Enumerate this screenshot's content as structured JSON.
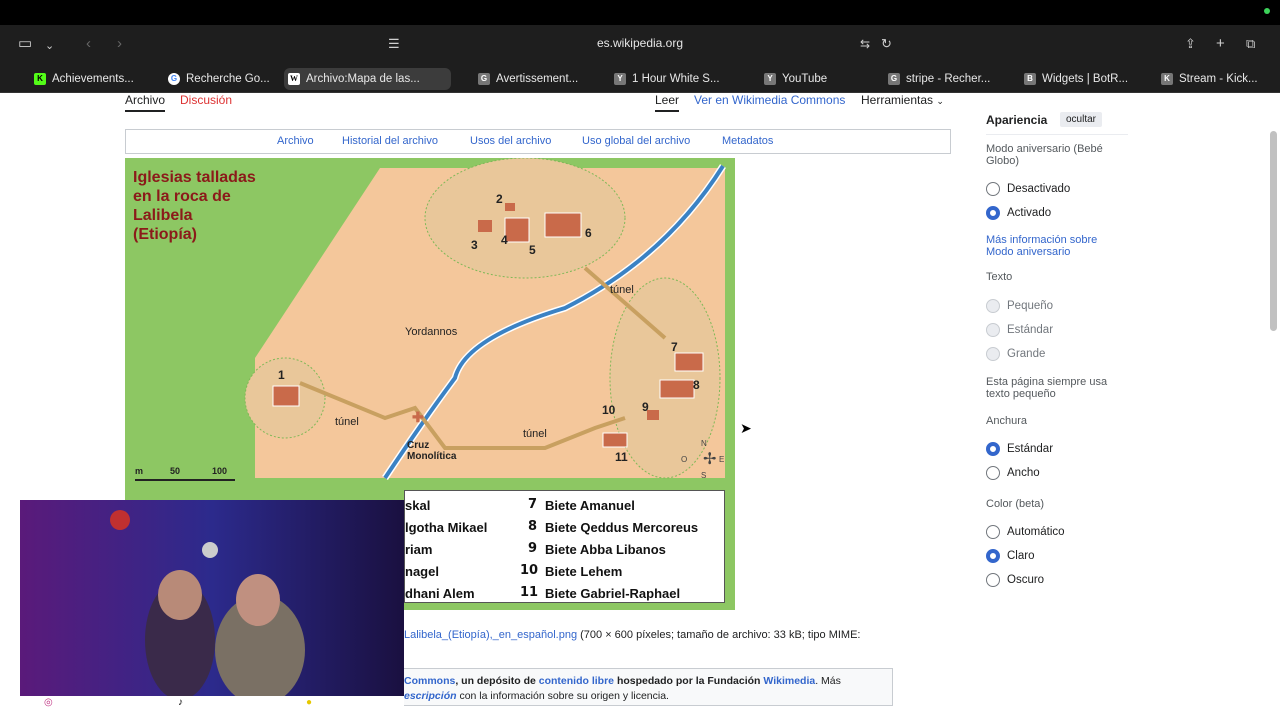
{
  "browser": {
    "url": "es.wikipedia.org",
    "tabs": [
      {
        "label": "Achievements...",
        "favicon": "K",
        "favicon_color": "#53fc18"
      },
      {
        "label": "Recherche Go...",
        "favicon": "G",
        "favicon_color": "#ffffff"
      },
      {
        "label": "Archivo:Mapa de las...",
        "favicon": "W",
        "favicon_color": "#ffffff",
        "active": true
      },
      {
        "label": "Avertissement...",
        "favicon": "G",
        "favicon_color": "#888888"
      },
      {
        "label": "1 Hour White S...",
        "favicon": "Y",
        "favicon_color": "#888888"
      },
      {
        "label": "YouTube",
        "favicon": "Y",
        "favicon_color": "#888888"
      },
      {
        "label": "stripe - Recher...",
        "favicon": "G",
        "favicon_color": "#888888"
      },
      {
        "label": "Widgets | BotR...",
        "favicon": "B",
        "favicon_color": "#888888"
      },
      {
        "label": "Stream - Kick...",
        "favicon": "K",
        "favicon_color": "#888888"
      }
    ]
  },
  "wiki": {
    "ns_tabs": {
      "archivo": "Archivo",
      "discusion": "Discusión"
    },
    "view_tabs": {
      "leer": "Leer",
      "commons": "Ver en Wikimedia Commons",
      "herramientas": "Herramientas"
    },
    "file_tabs": [
      "Archivo",
      "Historial del archivo",
      "Usos del archivo",
      "Uso global del archivo",
      "Metadatos"
    ],
    "map": {
      "title_lines": [
        "Iglesias talladas",
        "en la roca de",
        "Lalibela",
        "(Etiopía)"
      ],
      "river_label": "Yordannos",
      "tunnel_label": "túnel",
      "cross_label_lines": [
        "Cruz",
        "Monolítica"
      ],
      "numbers": [
        "1",
        "2",
        "3",
        "4",
        "5",
        "6",
        "7",
        "8",
        "9",
        "10",
        "11"
      ],
      "scale": {
        "unit": "m",
        "mid": "50",
        "end": "100"
      },
      "compass": {
        "n": "N",
        "s": "S",
        "e": "E",
        "o": "O"
      },
      "legend_left": [
        "skal",
        "lgotha Mikael",
        "riam",
        "nagel",
        "dhani Alem"
      ],
      "legend_right": [
        {
          "num": "7",
          "name": "Biete Amanuel"
        },
        {
          "num": "8",
          "name": "Biete Qeddus Mercoreus"
        },
        {
          "num": "9",
          "name": "Biete Abba Libanos"
        },
        {
          "num": "10",
          "name": "Biete Lehem"
        },
        {
          "num": "11",
          "name": "Biete Gabriel-Raphael"
        }
      ]
    },
    "file_info": {
      "link": "Lalibela_(Etiopía),_en_español.png",
      "rest": " (700 × 600 píxeles; tamaño de archivo: 33 kB; tipo MIME:"
    },
    "commons_notice": {
      "commons": "Commons",
      "t1": ", un depósito de ",
      "libre": "contenido libre",
      "t2": " hospedado por la Fundación ",
      "wikimedia": "Wikimedia",
      "t3": ". Más",
      "desc": "escripción",
      "t4": " con la información sobre su origen y licencia."
    },
    "appearance": {
      "title": "Apariencia",
      "hide": "ocultar",
      "anniversary_label": "Modo aniversario (Bebé Globo)",
      "anniversary_options": [
        {
          "label": "Desactivado",
          "selected": false
        },
        {
          "label": "Activado",
          "selected": true
        }
      ],
      "more_info": "Más información sobre Modo aniversario",
      "text_label": "Texto",
      "text_options": [
        {
          "label": "Pequeño"
        },
        {
          "label": "Estándar"
        },
        {
          "label": "Grande"
        }
      ],
      "text_note": "Esta página siempre usa texto pequeño",
      "width_label": "Anchura",
      "width_options": [
        {
          "label": "Estándar",
          "selected": true
        },
        {
          "label": "Ancho",
          "selected": false
        }
      ],
      "color_label": "Color (beta)",
      "color_options": [
        {
          "label": "Automático",
          "selected": false
        },
        {
          "label": "Claro",
          "selected": true
        },
        {
          "label": "Oscuro",
          "selected": false
        }
      ]
    }
  },
  "colors": {
    "accent": "#3366cc",
    "map_green": "#8dc763",
    "map_sand": "#f4c79b",
    "river": "#3b82c4"
  }
}
